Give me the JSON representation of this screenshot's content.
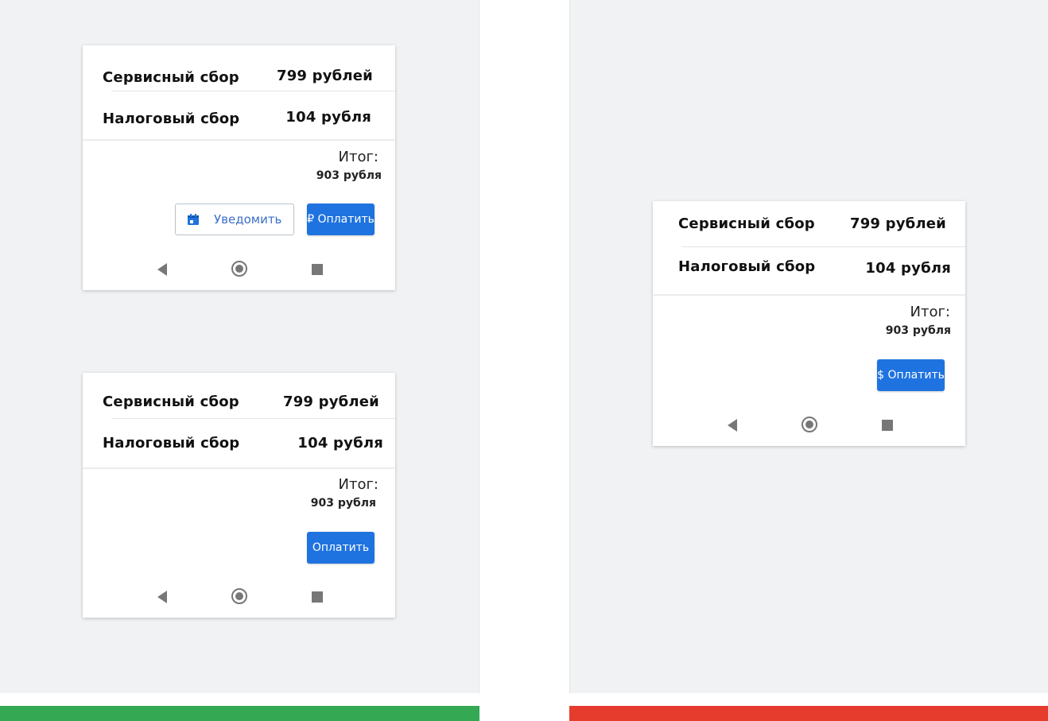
{
  "colors": {
    "good_strip": "#34a853",
    "bad_strip": "#e53c2e",
    "accent": "#1f73e0"
  },
  "cards": [
    {
      "service_label": "Сервисный сбор",
      "service_value": "799 рублей",
      "tax_label": "Налоговый сбор",
      "tax_value": "104 рубля",
      "total_label": "Итог:",
      "total_value": "903 рубля",
      "notify_label": "Уведомить",
      "pay_label": "₽ Оплатить"
    },
    {
      "service_label": "Сервисный сбор",
      "service_value": "799 рублей",
      "tax_label": "Налоговый сбор",
      "tax_value": "104 рубля",
      "total_label": "Итог:",
      "total_value": "903 рубля",
      "pay_label": "Оплатить"
    },
    {
      "service_label": "Сервисный сбор",
      "service_value": "799 рублей",
      "tax_label": "Налоговый сбор",
      "tax_value": "104 рубля",
      "total_label": "Итог:",
      "total_value": "903 рубля",
      "pay_label": "$ Оплатить"
    }
  ],
  "nav_icons": [
    "back-icon",
    "home-icon",
    "recent-apps-icon"
  ]
}
